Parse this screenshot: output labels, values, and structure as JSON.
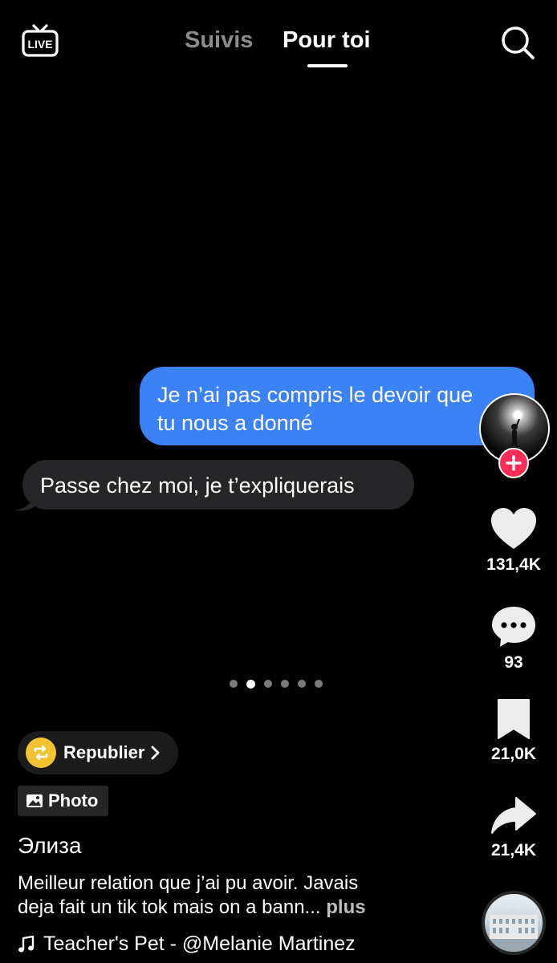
{
  "header": {
    "live_label": "LIVE",
    "tabs": [
      {
        "label": "Suivis",
        "active": false
      },
      {
        "label": "Pour toi",
        "active": true
      }
    ]
  },
  "chat": {
    "sent_message_lines": [
      "Je n’ai pas compris le devoir que",
      "tu nous a donné"
    ],
    "received_message": "Passe chez moi, je t’expliquerais",
    "sent_color": "#3a82f6",
    "received_color": "#262628"
  },
  "carousel": {
    "total": 6,
    "current": 2
  },
  "actions": {
    "likes": "131,4K",
    "comments": "93",
    "saves": "21,0K",
    "shares": "21,4K"
  },
  "post": {
    "repost_label": "Republier",
    "type_label": "Photo",
    "username": "Элиза",
    "caption_lines": [
      "Meilleur relation que j’ai pu avoir.  Javais",
      "deja fait un tik tok mais on a bann..."
    ],
    "more_label": "plus",
    "music": "Teacher's Pet - @Melanie Martinez"
  },
  "colors": {
    "accent": "#ff2c55",
    "repost": "#f2c233",
    "background": "#000000"
  },
  "icons": [
    "live-tv-icon",
    "search-icon",
    "plus-icon",
    "heart-icon",
    "comment-icon",
    "bookmark-icon",
    "share-icon",
    "repost-icon",
    "chevron-right-icon",
    "image-icon",
    "music-note-icon"
  ]
}
